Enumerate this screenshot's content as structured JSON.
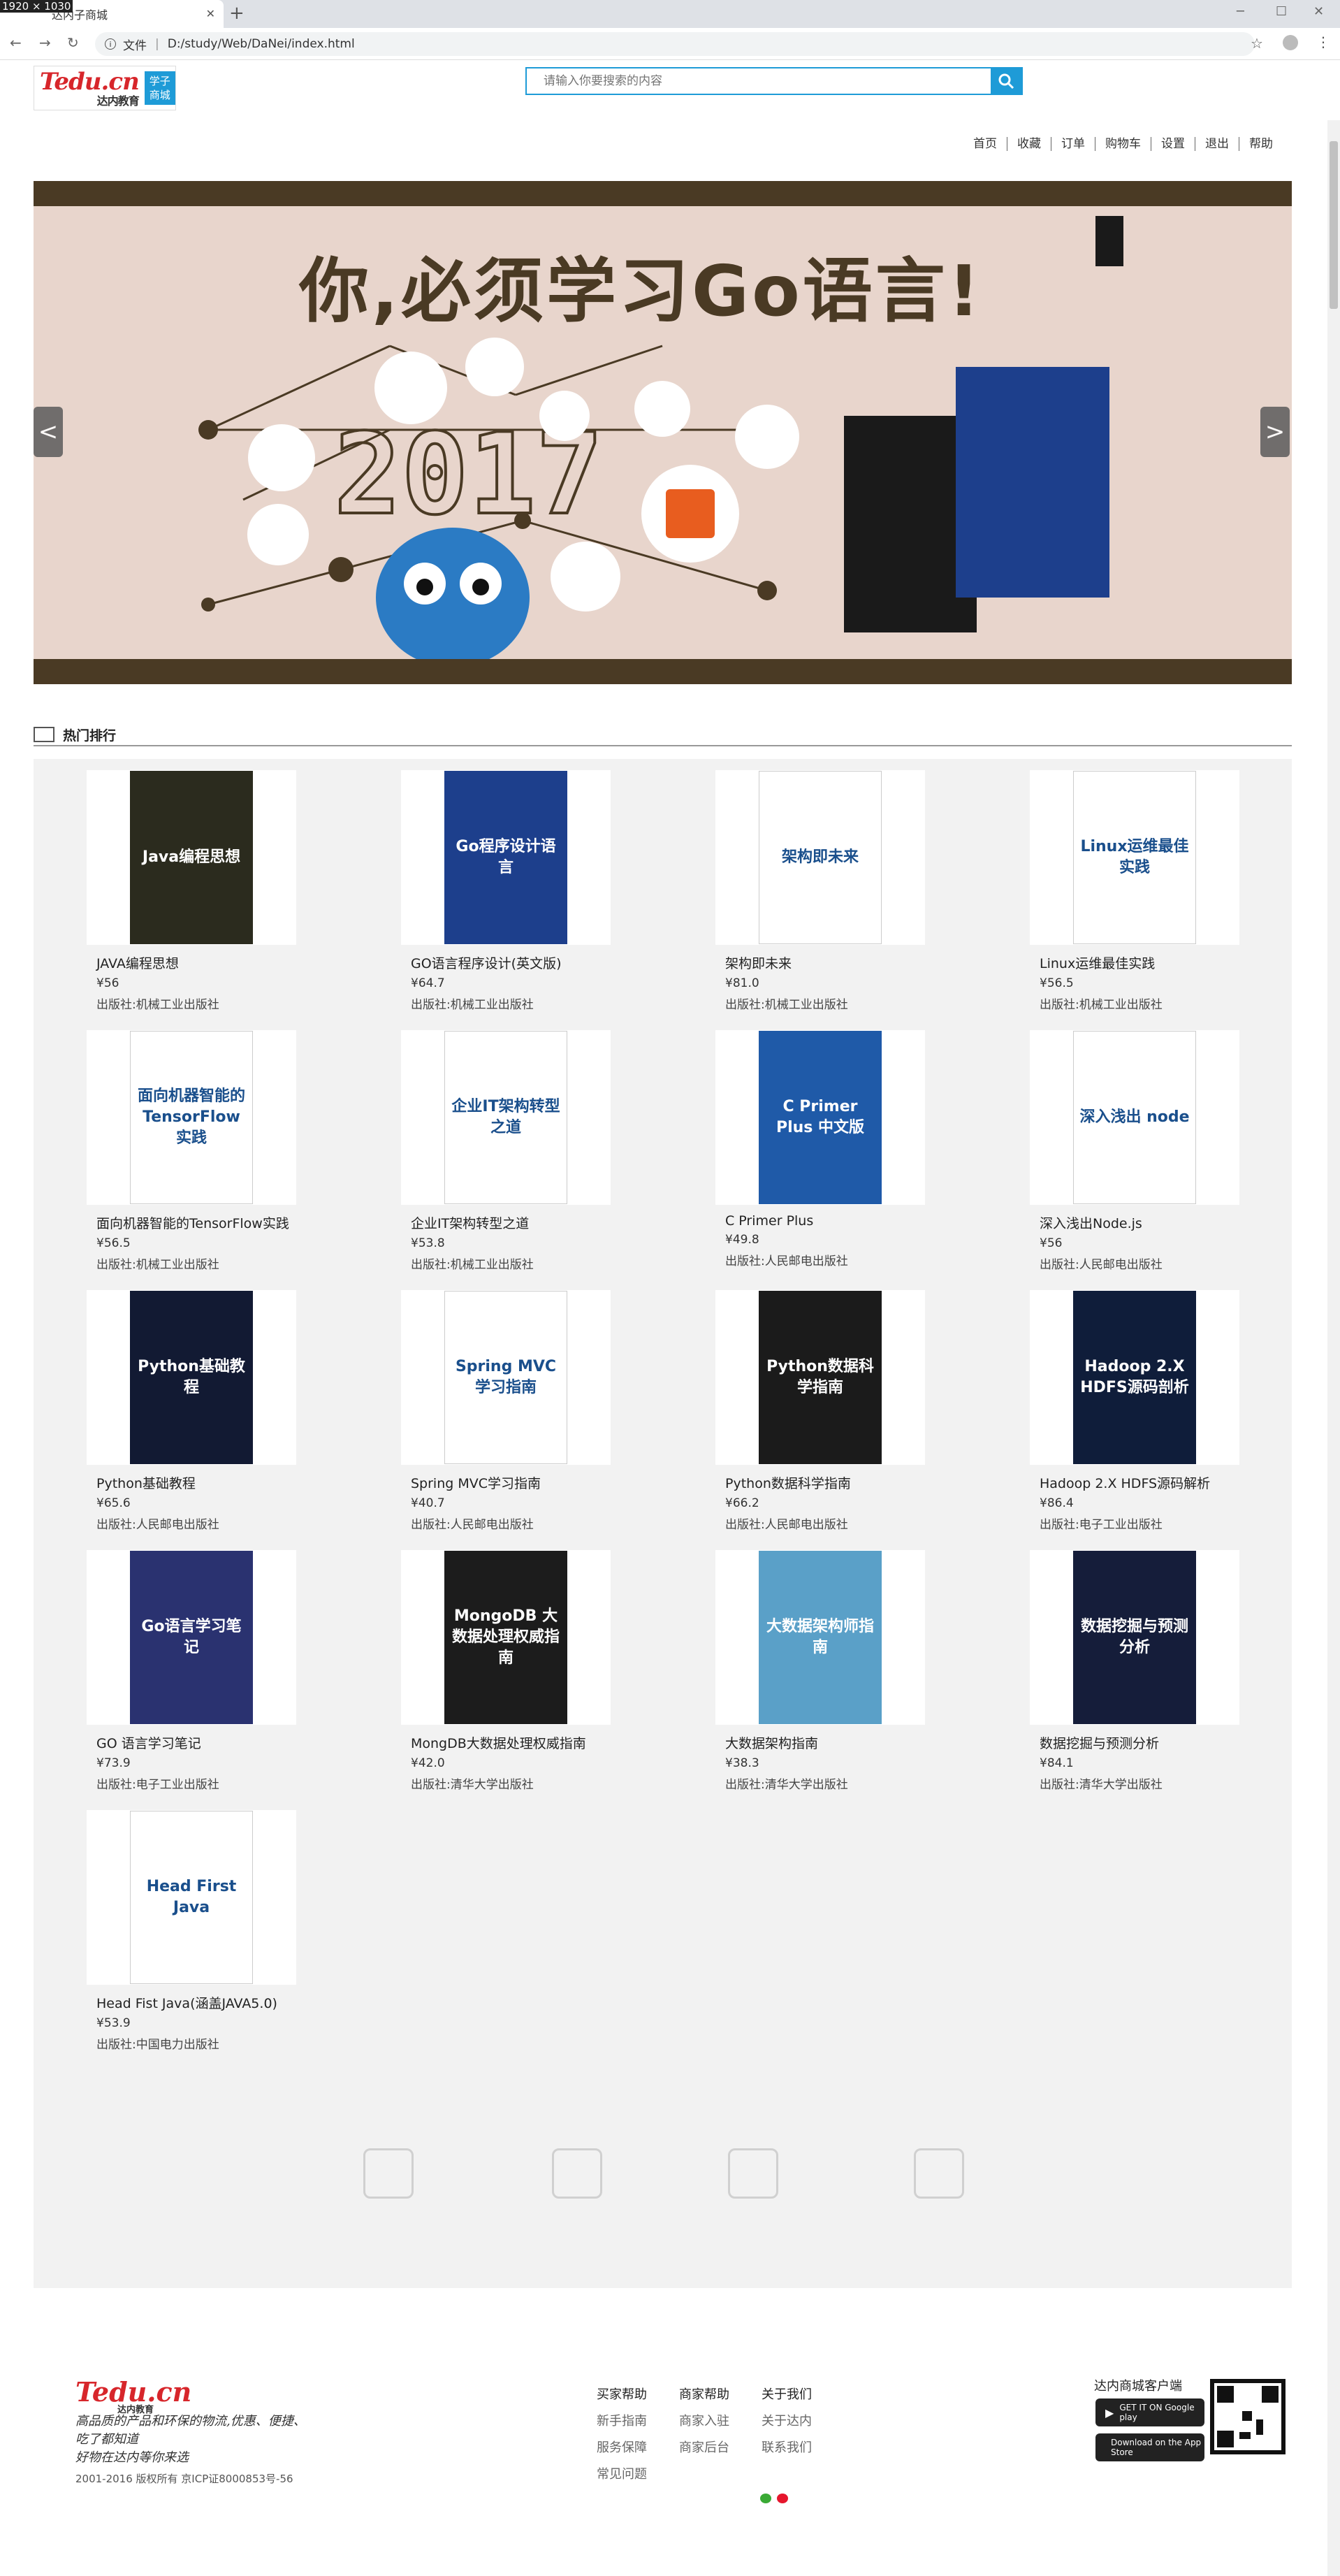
{
  "browser": {
    "tab_title": "达内子商城",
    "dimension_label": "1920 × 1030",
    "address": "D:/study/Web/DaNei/index.html",
    "file_label": "文件"
  },
  "header": {
    "logo_text": "Tedu.cn",
    "logo_sub": "达内教育",
    "logo_tag": "学子商城",
    "search_placeholder": "请输入你要搜索的内容"
  },
  "topnav": [
    "首页",
    "收藏",
    "订单",
    "购物车",
    "设置",
    "退出",
    "帮助"
  ],
  "banner": {
    "headline": "你,必须学习Go语言!",
    "year": "2017",
    "prev": "<",
    "next": ">",
    "active_dot": 4
  },
  "section": {
    "title": "热门排行"
  },
  "books": [
    {
      "name": "JAVA编程思想",
      "price": "¥56",
      "publisher": "出版社:机械工业出版社",
      "cover_title": "Java编程思想",
      "cover_color": "#2b2b1e"
    },
    {
      "name": "GO语言程序设计(英文版)",
      "price": "¥64.7",
      "publisher": "出版社:机械工业出版社",
      "cover_title": "Go程序设计语言",
      "cover_color": "#1d3f8c"
    },
    {
      "name": "架构即未来",
      "price": "¥81.0",
      "publisher": "出版社:机械工业出版社",
      "cover_title": "架构即未来",
      "cover_color": "#ffffff"
    },
    {
      "name": "Linux运维最佳实践",
      "price": "¥56.5",
      "publisher": "出版社:机械工业出版社",
      "cover_title": "Linux运维最佳实践",
      "cover_color": "#ffffff"
    },
    {
      "name": "面向机器智能的TensorFlow实践",
      "price": "¥56.5",
      "publisher": "出版社:机械工业出版社",
      "cover_title": "面向机器智能的TensorFlow实践",
      "cover_color": "#ffffff"
    },
    {
      "name": "企业IT架构转型之道",
      "price": "¥53.8",
      "publisher": "出版社:机械工业出版社",
      "cover_title": "企业IT架构转型之道",
      "cover_color": "#ffffff"
    },
    {
      "name": "C Primer Plus",
      "price": "¥49.8",
      "publisher": "出版社:人民邮电出版社",
      "cover_title": "C Primer Plus 中文版",
      "cover_color": "#1f5aa8"
    },
    {
      "name": "深入浅出Node.js",
      "price": "¥56",
      "publisher": "出版社:人民邮电出版社",
      "cover_title": "深入浅出 node",
      "cover_color": "#ffffff"
    },
    {
      "name": "Python基础教程",
      "price": "¥65.6",
      "publisher": "出版社:人民邮电出版社",
      "cover_title": "Python基础教程",
      "cover_color": "#121a33"
    },
    {
      "name": "Spring MVC学习指南",
      "price": "¥40.7",
      "publisher": "出版社:人民邮电出版社",
      "cover_title": "Spring MVC 学习指南",
      "cover_color": "#ffffff"
    },
    {
      "name": "Python数据科学指南",
      "price": "¥66.2",
      "publisher": "出版社:人民邮电出版社",
      "cover_title": "Python数据科学指南",
      "cover_color": "#1b1b1b"
    },
    {
      "name": "Hadoop 2.X HDFS源码解析",
      "price": "¥86.4",
      "publisher": "出版社:电子工业出版社",
      "cover_title": "Hadoop 2.X HDFS源码剖析",
      "cover_color": "#0f1d3a"
    },
    {
      "name": "GO 语言学习笔记",
      "price": "¥73.9",
      "publisher": "出版社:电子工业出版社",
      "cover_title": "Go语言学习笔记",
      "cover_color": "#2a3270"
    },
    {
      "name": "MongDB大数据处理权威指南",
      "price": "¥42.0",
      "publisher": "出版社:清华大学出版社",
      "cover_title": "MongoDB 大数据处理权威指南",
      "cover_color": "#1c1c1c"
    },
    {
      "name": "大数据架构指南",
      "price": "¥38.3",
      "publisher": "出版社:清华大学出版社",
      "cover_title": "大数据架构师指南",
      "cover_color": "#5aa0c8"
    },
    {
      "name": "数据挖掘与预测分析",
      "price": "¥84.1",
      "publisher": "出版社:清华大学出版社",
      "cover_title": "数据挖掘与预测分析",
      "cover_color": "#151d3a"
    },
    {
      "name": "Head Fist Java(涵盖JAVA5.0)",
      "price": "¥53.9",
      "publisher": "出版社:中国电力出版社",
      "cover_title": "Head First Java",
      "cover_color": "#ffffff"
    }
  ],
  "features": [
    "crown-icon",
    "clipboard-icon",
    "graduate-icon",
    "tag-icon"
  ],
  "footer": {
    "logo_text": "Tedu.cn",
    "logo_sub": "达内教育",
    "slogan": [
      "高品质的产品和环保的物流,优惠、便捷、",
      "吃了都知道",
      "好物在达内等你来选"
    ],
    "copyright": "2001-2016 版权所有 京ICP证8000853号-56",
    "col1": [
      "买家帮助",
      "新手指南",
      "服务保障",
      "常见问题"
    ],
    "col2": [
      "商家帮助",
      "商家入驻",
      "商家后台"
    ],
    "col3": [
      "关于我们",
      "关于达内",
      "联系我们"
    ],
    "app_title": "达内商城客户端",
    "google_play": "GET IT ON Google play",
    "app_store": "Download on the App Store"
  }
}
